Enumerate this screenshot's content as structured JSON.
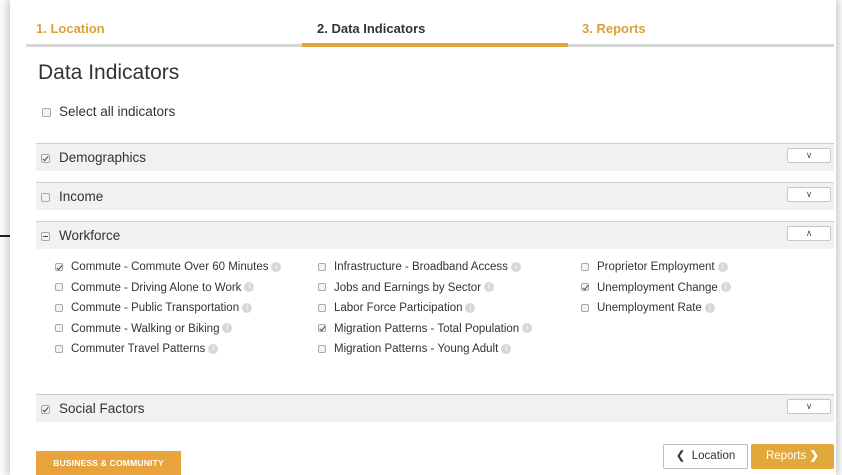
{
  "steps": [
    {
      "label": "1. Location"
    },
    {
      "label": "2. Data Indicators"
    },
    {
      "label": "3. Reports"
    }
  ],
  "page_title": "Data Indicators",
  "select_all_label": "Select all indicators",
  "sections": {
    "demographics": {
      "label": "Demographics",
      "checked": true
    },
    "income": {
      "label": "Income",
      "checked": false
    },
    "workforce": {
      "label": "Workforce",
      "state": "partial"
    },
    "social": {
      "label": "Social Factors",
      "checked": true
    }
  },
  "toggle_icons": {
    "collapsed": "chevron-down-icon",
    "expanded": "chevron-up-icon"
  },
  "indicators": {
    "col1": [
      {
        "label": "Commute - Commute Over 60 Minutes",
        "checked": true
      },
      {
        "label": "Commute - Driving Alone to Work",
        "checked": false
      },
      {
        "label": "Commute - Public Transportation",
        "checked": false
      },
      {
        "label": "Commute - Walking or Biking",
        "checked": false
      },
      {
        "label": "Commuter Travel Patterns",
        "checked": false
      }
    ],
    "col2": [
      {
        "label": "Infrastructure - Broadband Access",
        "checked": false
      },
      {
        "label": "Jobs and Earnings by Sector",
        "checked": false
      },
      {
        "label": "Labor Force Participation",
        "checked": false
      },
      {
        "label": "Migration Patterns - Total Population",
        "checked": true
      },
      {
        "label": "Migration Patterns - Young Adult",
        "checked": false
      }
    ],
    "col3": [
      {
        "label": "Proprietor Employment",
        "checked": false
      },
      {
        "label": "Unemployment Change",
        "checked": true
      },
      {
        "label": "Unemployment Rate",
        "checked": false
      }
    ]
  },
  "footer": {
    "business_label": "BUSINESS & COMMUNITY",
    "location_button": "Location",
    "reports_button": "Reports"
  },
  "colors": {
    "accent": "#e1a93b",
    "section_bg": "#f1f1f1"
  }
}
